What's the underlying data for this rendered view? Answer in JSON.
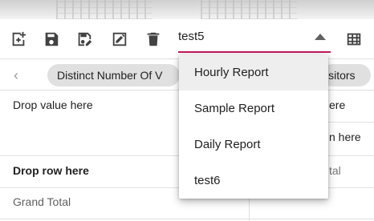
{
  "toolbar": {
    "icons": [
      {
        "name": "new-report-icon"
      },
      {
        "name": "save-icon"
      },
      {
        "name": "save-as-icon"
      },
      {
        "name": "rename-icon"
      },
      {
        "name": "delete-icon"
      },
      {
        "name": "grid-view-icon"
      }
    ],
    "report_select": {
      "value": "test5"
    }
  },
  "groupbar": {
    "chips": [
      {
        "label": "Distinct Number Of V"
      },
      {
        "label": "isitors"
      }
    ]
  },
  "pivot": {
    "drop_value": "Drop value here",
    "drop_value_right": "ere",
    "drop_column_right": "n here",
    "drop_row": "Drop row here",
    "right_partial": "tal",
    "grand_total": "Grand Total"
  },
  "dropdown": {
    "options": [
      {
        "label": "Hourly Report",
        "highlighted": true
      },
      {
        "label": "Sample Report",
        "highlighted": false
      },
      {
        "label": "Daily Report",
        "highlighted": false
      },
      {
        "label": "test6",
        "highlighted": false
      }
    ]
  },
  "colors": {
    "accent": "#c2185b",
    "chip_bg": "#e0e0e0",
    "icon": "#424242"
  }
}
